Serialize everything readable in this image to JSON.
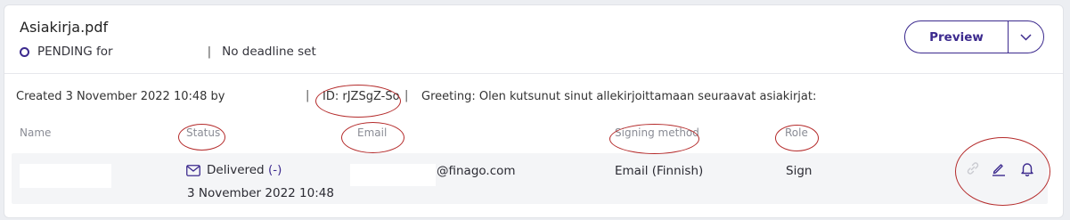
{
  "document": {
    "filename": "Asiakirja.pdf",
    "status_text": "PENDING for",
    "separator": "|",
    "deadline": "No deadline set"
  },
  "actions": {
    "preview_label": "Preview",
    "dropdown_icon": "chevron-down-icon"
  },
  "meta": {
    "created": "Created 3 November 2022 10:48 by",
    "separator": "|",
    "id": "ID: rJZSgZ-So",
    "greeting": "Greeting: Olen kutsunut sinut allekirjoittamaan seuraavat asiakirjat:"
  },
  "table": {
    "headers": {
      "name": "Name",
      "status": "Status",
      "email": "Email",
      "signing_method": "Signing method",
      "role": "Role"
    },
    "rows": [
      {
        "status": "Delivered",
        "status_link": "(-)",
        "status_date": "3 November 2022 10:48",
        "email_domain": "@finago.com",
        "signing_method": "Email (Finnish)",
        "role": "Sign",
        "icons": [
          "link-icon",
          "edit-icon",
          "bell-icon"
        ]
      }
    ]
  },
  "colors": {
    "accent": "#3c2a8e",
    "annotation": "#b42a2a",
    "row_background": "#f4f5f7"
  }
}
